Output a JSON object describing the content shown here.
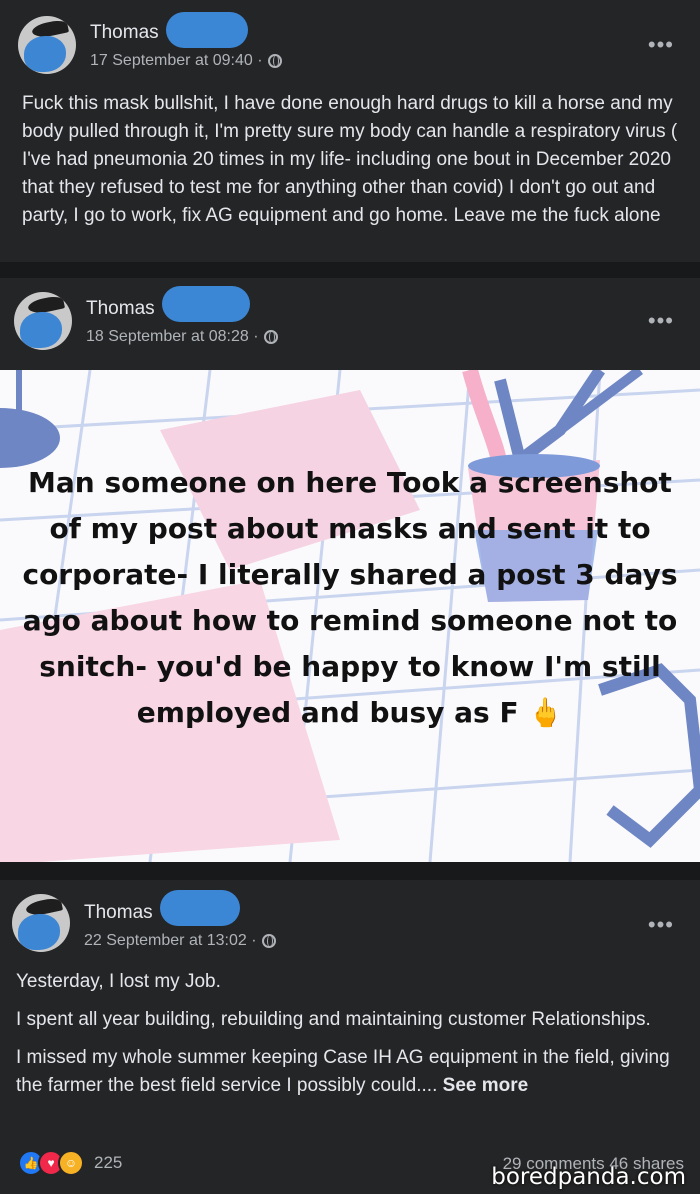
{
  "posts": [
    {
      "author": "Thomas",
      "date": "17 September at 09:40 ·",
      "more": "•••",
      "text": "Fuck this mask bullshit, I have done enough hard drugs to kill a horse and my body pulled through it, I'm pretty sure my body can handle a respiratory virus ( I've had pneumonia 20 times in my life- including one bout in December 2020 that they refused to test me for anything other than covid) I don't go out and party, I go to work, fix AG equipment and go home. Leave me the fuck alone"
    },
    {
      "author": "Thomas",
      "date": "18 September at 08:28 ·",
      "more": "•••",
      "image_text": "Man someone on here Took a screenshot of my post about masks and sent it to corporate- I literally shared a post 3 days ago about how to remind someone not to snitch- you'd be happy to know I'm still employed and busy as F 🖕"
    },
    {
      "author": "Thomas",
      "date": "22 September at 13:02 ·",
      "more": "•••",
      "paragraphs": [
        "Yesterday, I lost my Job.",
        "I spent all year building, rebuilding and maintaining customer Relationships.",
        "I missed my whole summer keeping Case IH AG equipment in the field, giving the farmer the best field service I possibly could...."
      ],
      "see_more": "See more",
      "reaction_count": "225",
      "comments_shares": "29 comments 46 shares"
    }
  ],
  "watermark": "boredpanda.com",
  "icons": [
    "globe-icon",
    "more-options-icon",
    "like-reaction-icon",
    "love-reaction-icon",
    "care-reaction-icon"
  ]
}
